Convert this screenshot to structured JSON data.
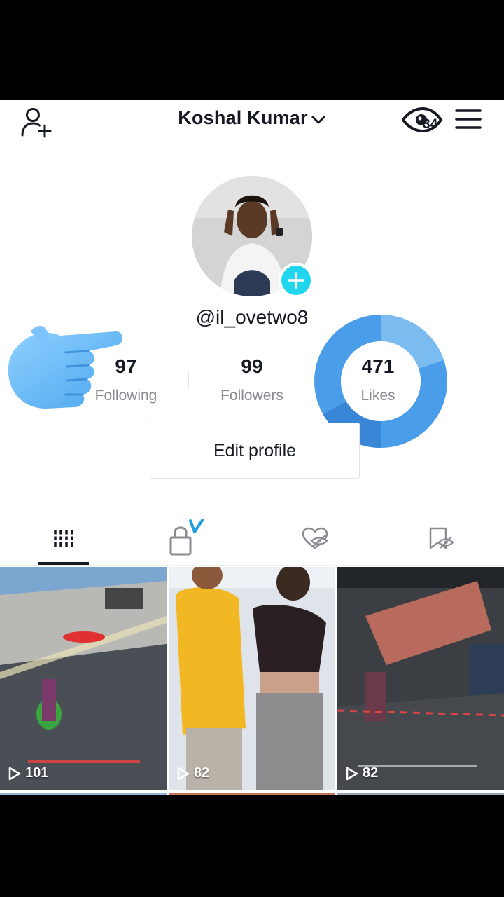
{
  "header": {
    "title": "Koshal Kumar",
    "views_count": "34",
    "icons": [
      "add-user-icon",
      "chevron-down-icon",
      "eye-icon",
      "menu-icon"
    ]
  },
  "profile": {
    "username": "@il_ovetwo8",
    "edit_label": "Edit profile"
  },
  "stats": {
    "following": {
      "value": "97",
      "label": "Following"
    },
    "followers": {
      "value": "99",
      "label": "Followers"
    },
    "likes": {
      "value": "471",
      "label": "Likes"
    }
  },
  "tabs": [
    {
      "name": "videos",
      "icon": "grid-icon",
      "active": true
    },
    {
      "name": "private",
      "icon": "lock-icon",
      "active": false
    },
    {
      "name": "liked",
      "icon": "heart-hidden-icon",
      "active": false
    },
    {
      "name": "favorites",
      "icon": "bookmark-hidden-icon",
      "active": false
    }
  ],
  "videos": [
    {
      "views": "101"
    },
    {
      "views": "82"
    },
    {
      "views": "82"
    }
  ],
  "colors": {
    "accent": "#20d5ec",
    "donut": "#4a9de8",
    "text": "#161823",
    "muted": "#8a8b91"
  }
}
